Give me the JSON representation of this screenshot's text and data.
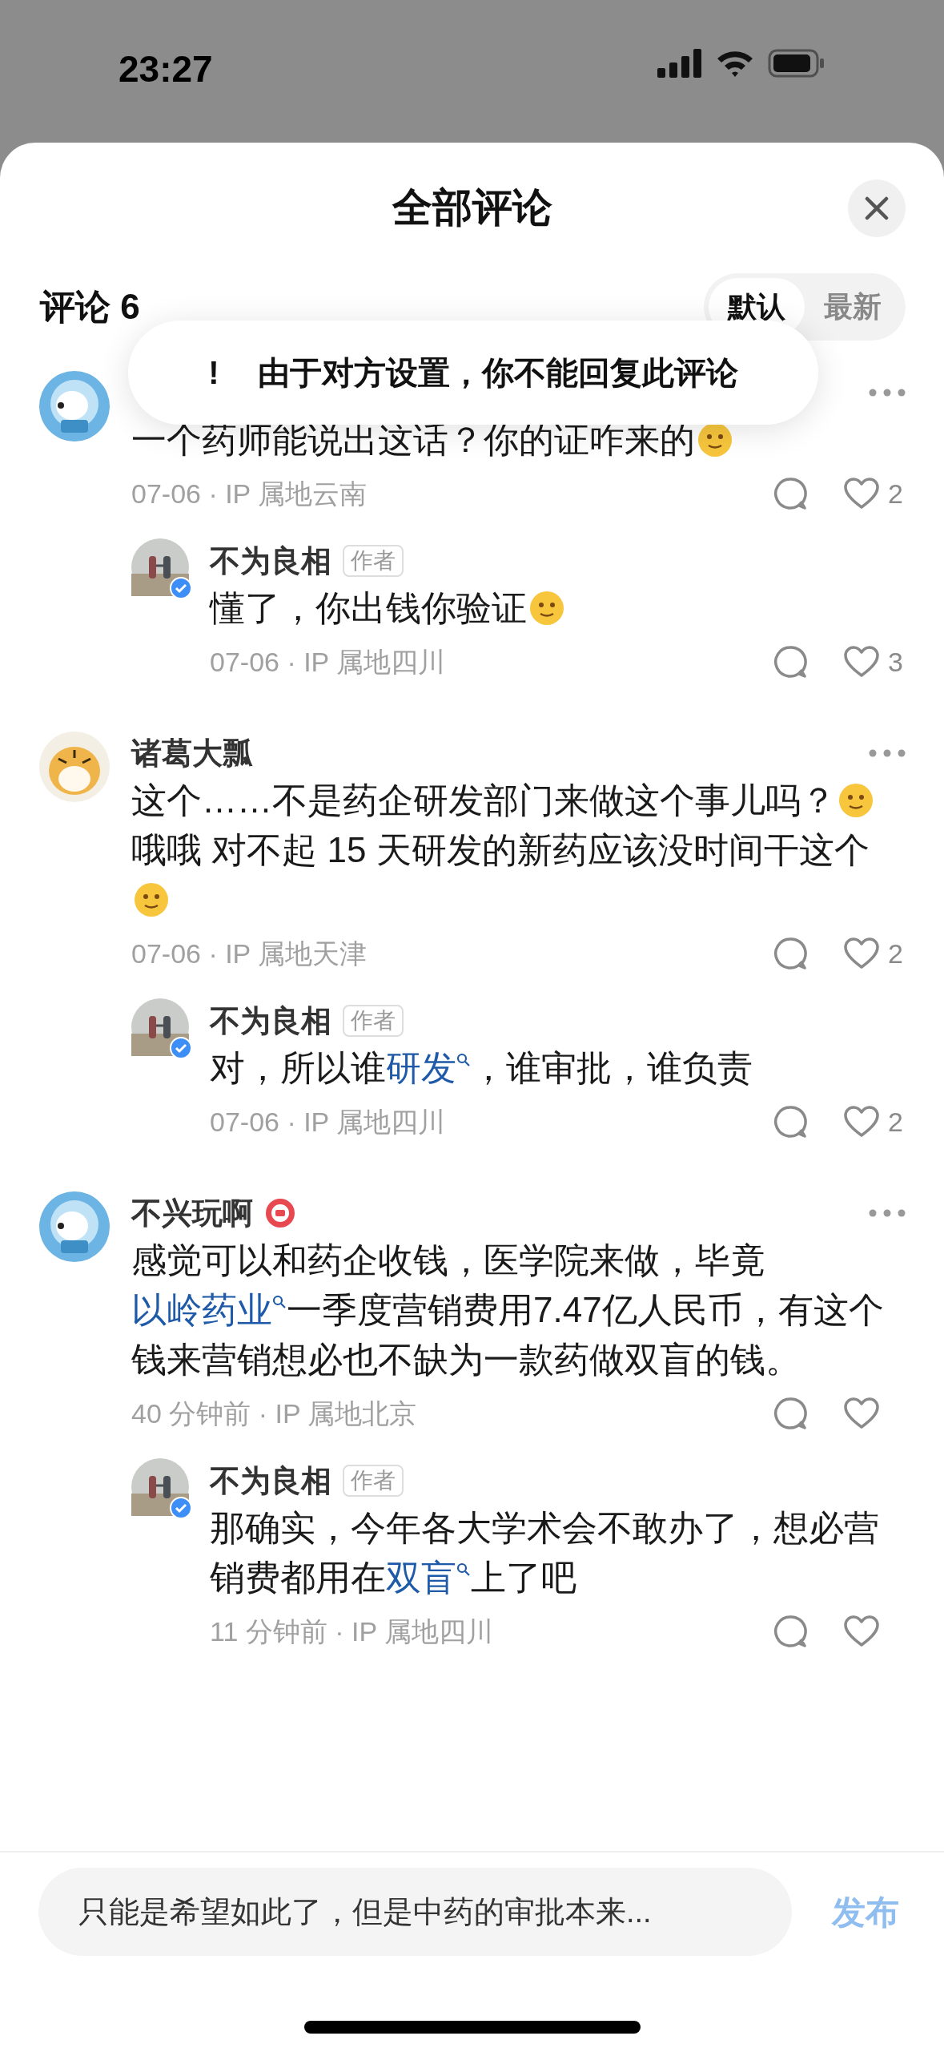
{
  "status_bar": {
    "time": "23:27"
  },
  "sheet": {
    "title": "全部评论"
  },
  "toast": {
    "icon": "!",
    "message": "由于对方设置，你不能回复此评论"
  },
  "header": {
    "label": "评论 6",
    "sort_tabs": [
      {
        "label": "默认",
        "selected": true
      },
      {
        "label": "最新",
        "selected": false
      }
    ]
  },
  "comments": [
    {
      "avatar": {
        "kind": "bear"
      },
      "badge": false,
      "segments": [
        {
          "kind": "text",
          "text": "一个药师能说出这话？你的证咋来的"
        },
        {
          "kind": "emoji"
        }
      ],
      "meta": "07-06 · IP 属地云南",
      "likes": "2",
      "replies": [
        {
          "name": "不为良相",
          "tag": "作者",
          "verified": true,
          "segments": [
            {
              "kind": "text",
              "text": "懂了，你出钱你验证"
            },
            {
              "kind": "emoji"
            }
          ],
          "meta": "07-06 · IP 属地四川",
          "likes": "3"
        }
      ]
    },
    {
      "name": "诸葛大瓢",
      "avatar": {
        "kind": "tiger"
      },
      "badge": false,
      "segments": [
        {
          "kind": "text",
          "text": "这个……不是药企研发部门来做这个事儿吗？"
        },
        {
          "kind": "emoji"
        },
        {
          "kind": "text",
          "text": "哦哦 对不起 15 天研发的新药应该没时间干这个"
        },
        {
          "kind": "emoji"
        }
      ],
      "meta": "07-06 · IP 属地天津",
      "likes": "2",
      "replies": [
        {
          "name": "不为良相",
          "tag": "作者",
          "verified": true,
          "segments": [
            {
              "kind": "text",
              "text": "对，所以谁"
            },
            {
              "kind": "link",
              "text": "研发"
            },
            {
              "kind": "text",
              "text": "，谁审批，谁负责"
            }
          ],
          "meta": "07-06 · IP 属地四川",
          "likes": "2"
        }
      ]
    },
    {
      "name": "不兴玩啊",
      "avatar": {
        "kind": "bear"
      },
      "badge": true,
      "segments": [
        {
          "kind": "text",
          "text": "感觉可以和药企收钱，医学院来做，毕竟"
        },
        {
          "kind": "link",
          "text": "以岭药业"
        },
        {
          "kind": "text",
          "text": "一季度营销费用7.47亿人民币，有这个钱来营销想必也不缺为一款药做双盲的钱。"
        }
      ],
      "meta": "40 分钟前 · IP 属地北京",
      "replies": [
        {
          "name": "不为良相",
          "tag": "作者",
          "verified": true,
          "segments": [
            {
              "kind": "text",
              "text": "那确实，今年各大学术会不敢办了，想必营销费都用在"
            },
            {
              "kind": "link",
              "text": "双盲"
            },
            {
              "kind": "text",
              "text": "上了吧"
            }
          ],
          "meta": "11 分钟前 · IP 属地四川"
        }
      ]
    }
  ],
  "composer": {
    "value": "只能是希望如此了，但是中药的审批本来...",
    "submit": "发布"
  }
}
